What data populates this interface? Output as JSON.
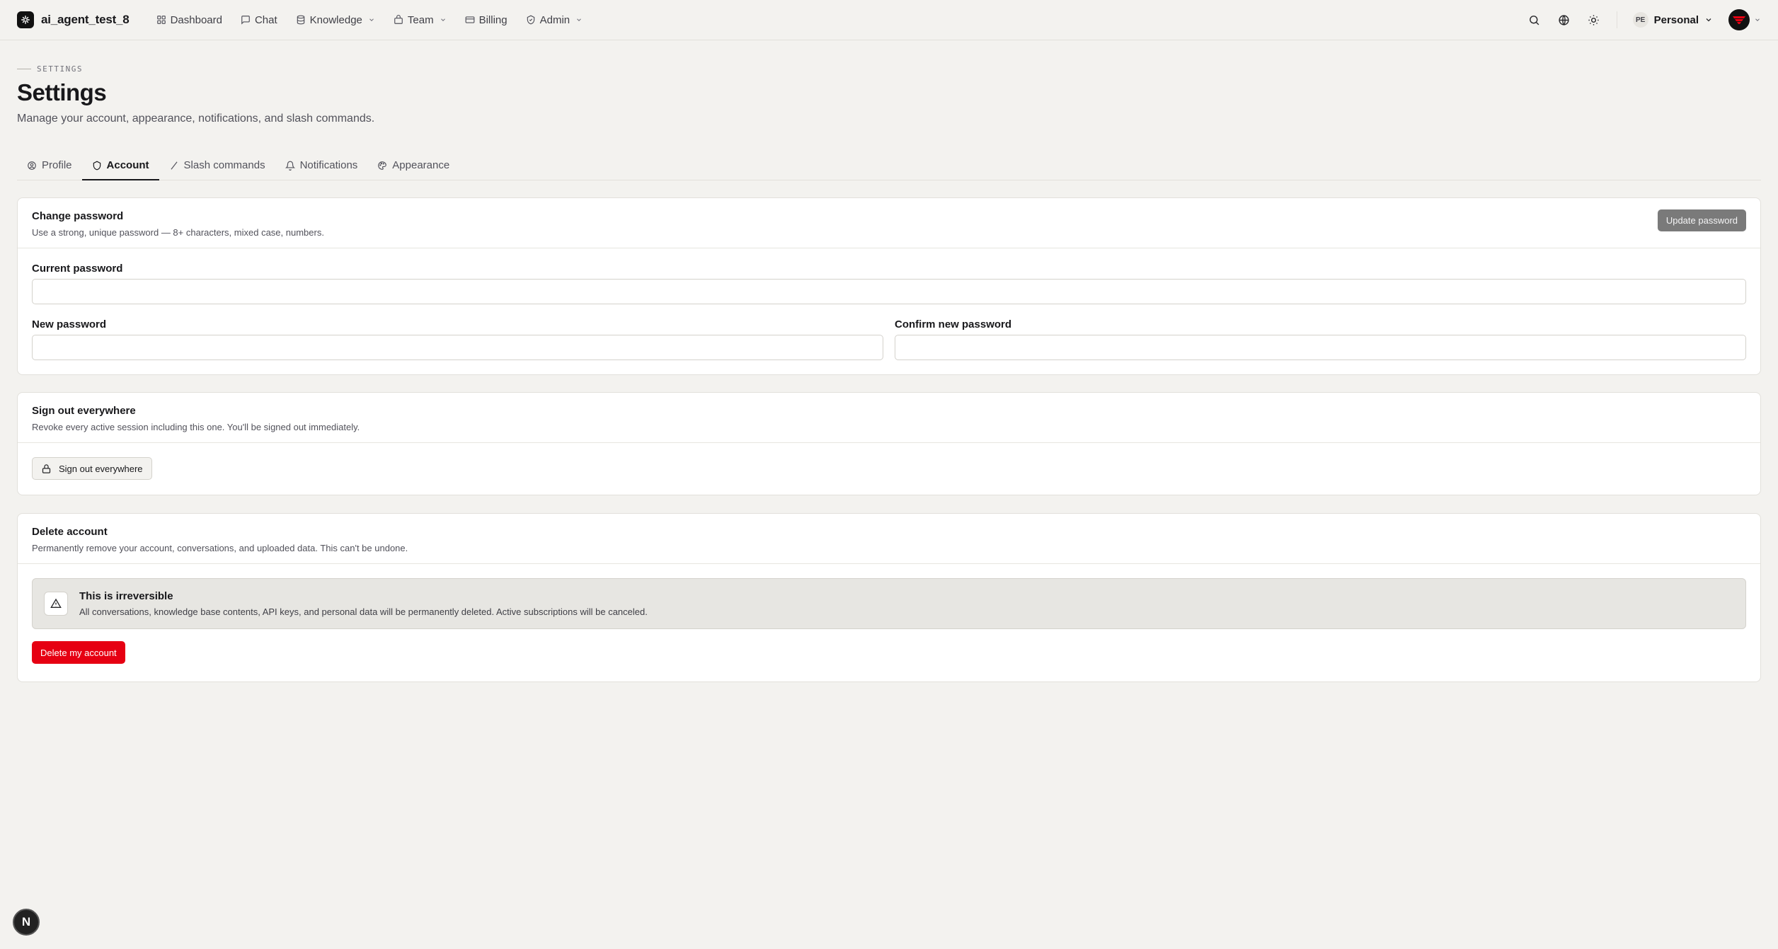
{
  "app": {
    "name": "ai_agent_test_8"
  },
  "nav": {
    "items": [
      {
        "label": "Dashboard",
        "icon": "grid-icon"
      },
      {
        "label": "Chat",
        "icon": "chat-icon"
      },
      {
        "label": "Knowledge",
        "icon": "database-icon",
        "dropdown": true
      },
      {
        "label": "Team",
        "icon": "team-icon",
        "dropdown": true
      },
      {
        "label": "Billing",
        "icon": "card-icon"
      },
      {
        "label": "Admin",
        "icon": "shield-icon",
        "dropdown": true
      }
    ]
  },
  "topbar": {
    "workspace_badge": "PE",
    "workspace_label": "Personal"
  },
  "header": {
    "eyebrow": "SETTINGS",
    "title": "Settings",
    "subtitle": "Manage your account, appearance, notifications, and slash commands."
  },
  "tabs": [
    {
      "label": "Profile",
      "icon": "user-circle-icon",
      "active": false
    },
    {
      "label": "Account",
      "icon": "shield-icon",
      "active": true
    },
    {
      "label": "Slash commands",
      "icon": "slash-icon",
      "active": false
    },
    {
      "label": "Notifications",
      "icon": "bell-icon",
      "active": false
    },
    {
      "label": "Appearance",
      "icon": "palette-icon",
      "active": false
    }
  ],
  "change_password": {
    "title": "Change password",
    "description": "Use a strong, unique password — 8+ characters, mixed case, numbers.",
    "update_button": "Update password",
    "current_label": "Current password",
    "current_value": "",
    "new_label": "New password",
    "new_value": "",
    "confirm_label": "Confirm new password",
    "confirm_value": ""
  },
  "sign_out": {
    "title": "Sign out everywhere",
    "description": "Revoke every active session including this one. You'll be signed out immediately.",
    "button": "Sign out everywhere"
  },
  "delete_account": {
    "title": "Delete account",
    "description": "Permanently remove your account, conversations, and uploaded data. This can't be undone.",
    "warning_title": "This is irreversible",
    "warning_text": "All conversations, knowledge base contents, API keys, and personal data will be permanently deleted. Active subscriptions will be canceled.",
    "button": "Delete my account"
  },
  "fab": {
    "label": "N"
  },
  "colors": {
    "background": "#f3f2ef",
    "danger": "#e60012",
    "accent": "#18181b"
  }
}
